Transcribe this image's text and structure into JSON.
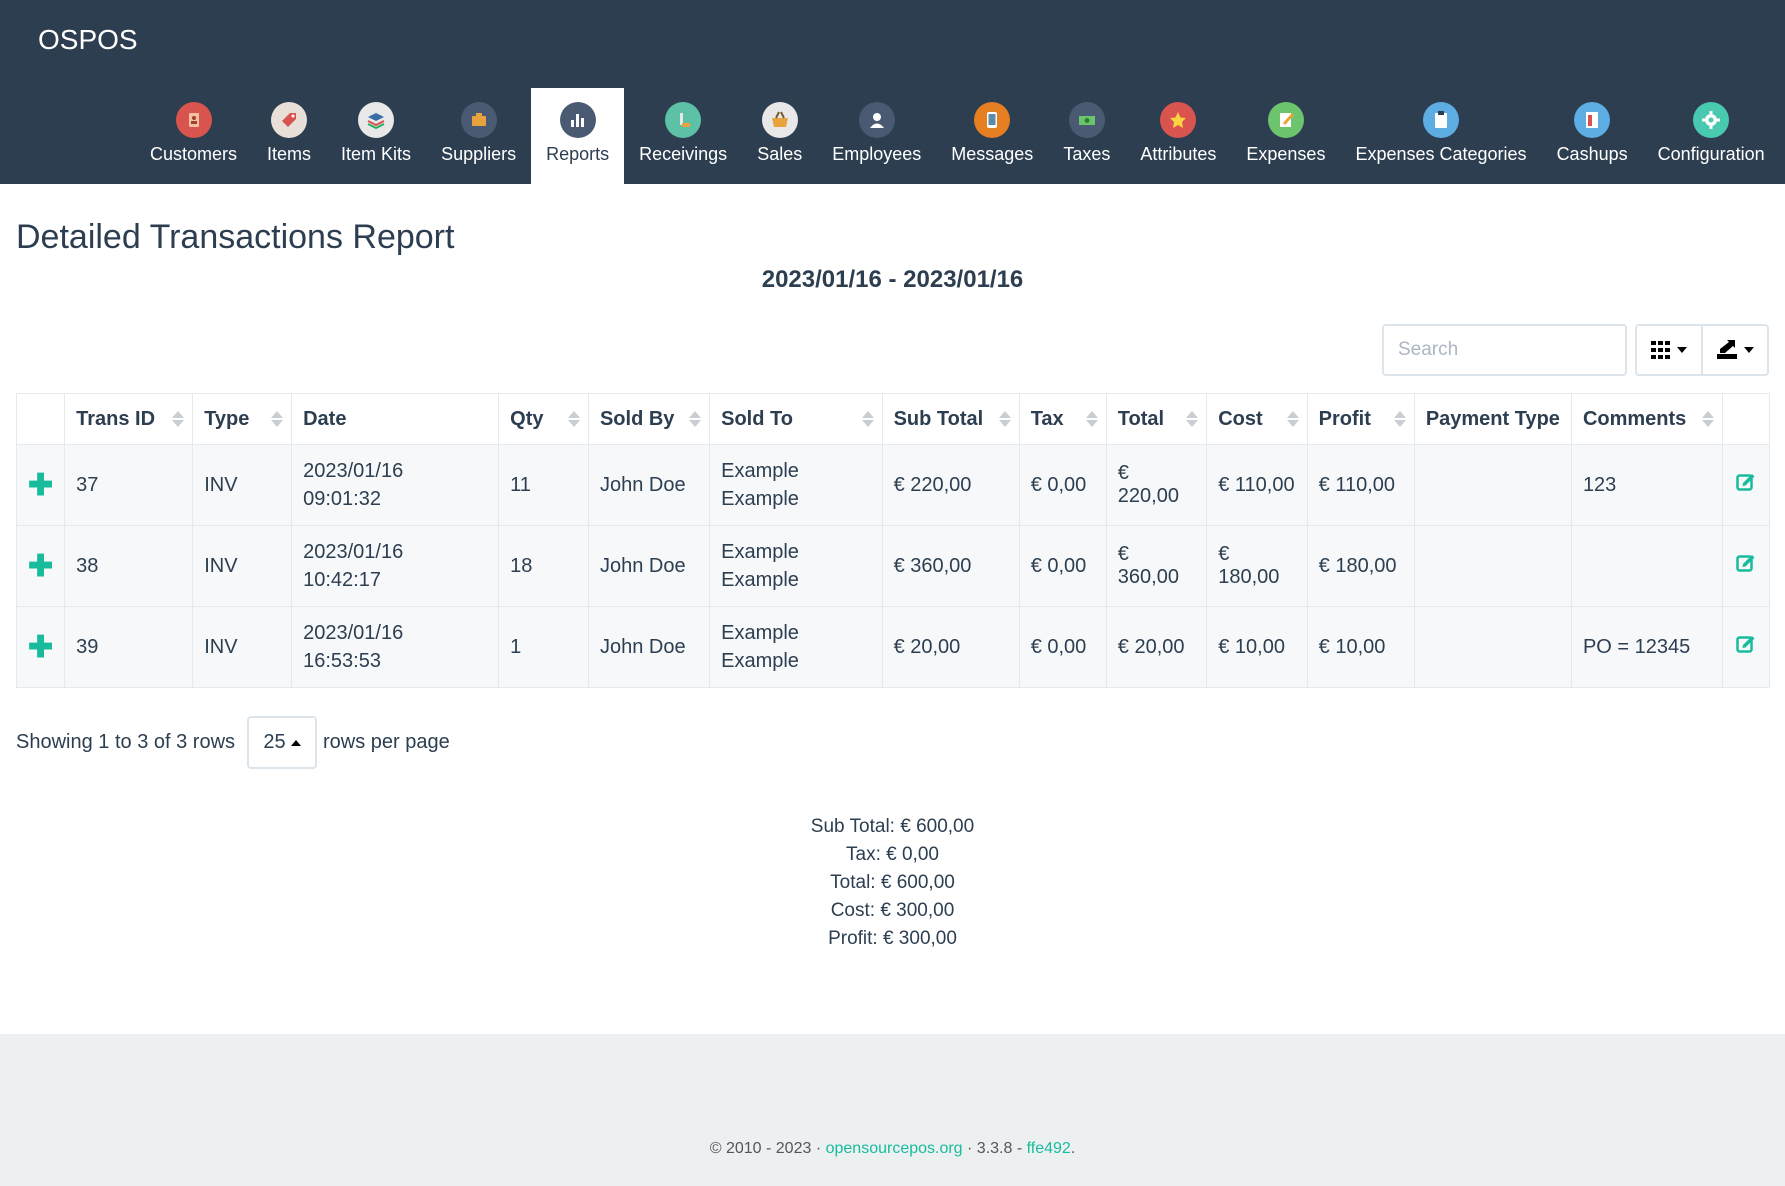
{
  "app": {
    "brand": "OSPOS"
  },
  "nav": [
    {
      "label": "Customers",
      "icon": "customers-icon",
      "color": "#d9534f"
    },
    {
      "label": "Items",
      "icon": "items-icon",
      "color": "#e8e0d8"
    },
    {
      "label": "Item Kits",
      "icon": "item-kits-icon",
      "color": "#e8e8e8"
    },
    {
      "label": "Suppliers",
      "icon": "suppliers-icon",
      "color": "#4a5a72"
    },
    {
      "label": "Reports",
      "icon": "reports-icon",
      "color": "#4a5a72",
      "active": true
    },
    {
      "label": "Receivings",
      "icon": "receivings-icon",
      "color": "#5cc1a7"
    },
    {
      "label": "Sales",
      "icon": "sales-icon",
      "color": "#e8e8e8"
    },
    {
      "label": "Employees",
      "icon": "employees-icon",
      "color": "#4a5a72"
    },
    {
      "label": "Messages",
      "icon": "messages-icon",
      "color": "#e67e22"
    },
    {
      "label": "Taxes",
      "icon": "taxes-icon",
      "color": "#4a5a72"
    },
    {
      "label": "Attributes",
      "icon": "attributes-icon",
      "color": "#d9534f"
    },
    {
      "label": "Expenses",
      "icon": "expenses-icon",
      "color": "#6cc46c"
    },
    {
      "label": "Expenses Categories",
      "icon": "expenses-categories-icon",
      "color": "#5dade2"
    },
    {
      "label": "Cashups",
      "icon": "cashups-icon",
      "color": "#5dade2"
    },
    {
      "label": "Configuration",
      "icon": "configuration-icon",
      "color": "#48c9b0"
    }
  ],
  "page": {
    "title": "Detailed Transactions Report",
    "date_range": "2023/01/16 - 2023/01/16"
  },
  "toolbar": {
    "search_placeholder": "Search"
  },
  "table": {
    "columns": [
      "Trans ID",
      "Type",
      "Date",
      "Qty",
      "Sold By",
      "Sold To",
      "Sub Total",
      "Tax",
      "Total",
      "Cost",
      "Profit",
      "Payment Type",
      "Comments"
    ],
    "rows": [
      {
        "id": "37",
        "type": "INV",
        "date1": "2023/01/16",
        "date2": "09:01:32",
        "qty": "11",
        "sold_by": "John Doe",
        "sold_to1": "Example",
        "sold_to2": "Example",
        "sub_total": "€ 220,00",
        "tax": "€ 0,00",
        "total": "€ 220,00",
        "cost": "€ 110,00",
        "profit": "€ 110,00",
        "payment_type": "",
        "comments": "123"
      },
      {
        "id": "38",
        "type": "INV",
        "date1": "2023/01/16",
        "date2": "10:42:17",
        "qty": "18",
        "sold_by": "John Doe",
        "sold_to1": "Example",
        "sold_to2": "Example",
        "sub_total": "€ 360,00",
        "tax": "€ 0,00",
        "total": "€ 360,00",
        "cost": "€ 180,00",
        "profit": "€ 180,00",
        "payment_type": "",
        "comments": ""
      },
      {
        "id": "39",
        "type": "INV",
        "date1": "2023/01/16",
        "date2": "16:53:53",
        "qty": "1",
        "sold_by": "John Doe",
        "sold_to1": "Example",
        "sold_to2": "Example",
        "sub_total": "€ 20,00",
        "tax": "€ 0,00",
        "total": "€ 20,00",
        "cost": "€ 10,00",
        "profit": "€ 10,00",
        "payment_type": "",
        "comments": "PO = 12345"
      }
    ]
  },
  "pagination": {
    "showing": "Showing 1 to 3 of 3 rows",
    "page_size": "25",
    "suffix": "rows per page"
  },
  "summary": {
    "sub_total": "Sub Total: € 600,00",
    "tax": "Tax: € 0,00",
    "total": "Total: € 600,00",
    "cost": "Cost: € 300,00",
    "profit": "Profit: € 300,00"
  },
  "footer": {
    "prefix": "© 2010 - 2023 · ",
    "link": "opensourcepos.org",
    "middle": " · 3.3.8 - ",
    "commit": "ffe492",
    "suffix": "."
  },
  "colors": {
    "accent": "#18bc9c",
    "navbar": "#2c3e50",
    "footer_bg": "#ecf0f1"
  }
}
